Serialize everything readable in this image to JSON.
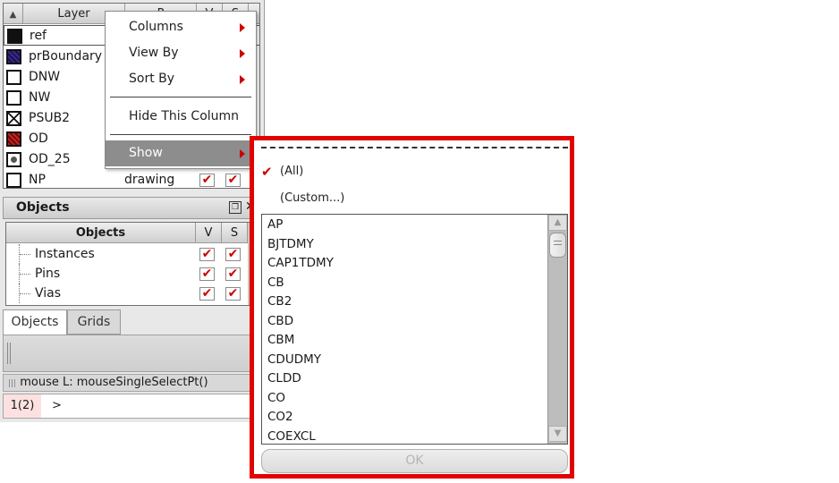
{
  "layers_table": {
    "columns": [
      "Layer",
      "P",
      "V",
      "S"
    ],
    "rows": [
      {
        "name": "ref",
        "purpose": "",
        "swatch": "#101010",
        "pattern": "dots-dark"
      },
      {
        "name": "prBoundary",
        "purpose": "",
        "swatch": "#3a2a8a",
        "pattern": "dots-purple"
      },
      {
        "name": "DNW",
        "purpose": "",
        "swatch": "#ffffff",
        "pattern": "outline"
      },
      {
        "name": "NW",
        "purpose": "",
        "swatch": "#ffffff",
        "pattern": "outline"
      },
      {
        "name": "PSUB2",
        "purpose": "",
        "swatch": "#ffffff",
        "pattern": "x-cross"
      },
      {
        "name": "OD",
        "purpose": "",
        "swatch": "#cc2222",
        "pattern": "hatch-red"
      },
      {
        "name": "OD_25",
        "purpose": "",
        "swatch": "#777777",
        "pattern": "dotted-gray"
      },
      {
        "name": "NP",
        "purpose": "drawing",
        "swatch": "#ffffff",
        "pattern": "outline"
      }
    ]
  },
  "objects_panel": {
    "title": "Objects",
    "columns": [
      "Objects",
      "V",
      "S"
    ],
    "rows": [
      "Instances",
      "Pins",
      "Vias"
    ]
  },
  "tabs": [
    "Objects",
    "Grids"
  ],
  "status": {
    "mouse": "mouse L: mouseSingleSelectPt()",
    "count": "1(2)",
    "prompt": ">"
  },
  "context_menu": {
    "items": [
      "Columns",
      "View By",
      "Sort By",
      "Hide This Column",
      "Show"
    ],
    "active": "Show",
    "arrow_color": "#cc0000"
  },
  "show_popup": {
    "options": [
      "(All)",
      "(Custom...)"
    ],
    "checked": "(All)",
    "layers": [
      "AP",
      "BJTDMY",
      "CAP1TDMY",
      "CB",
      "CB2",
      "CBD",
      "CBM",
      "CDUDMY",
      "CLDD",
      "CO",
      "CO2",
      "COEXCL"
    ],
    "ok_label": "OK",
    "highlight_color": "#e30000"
  }
}
